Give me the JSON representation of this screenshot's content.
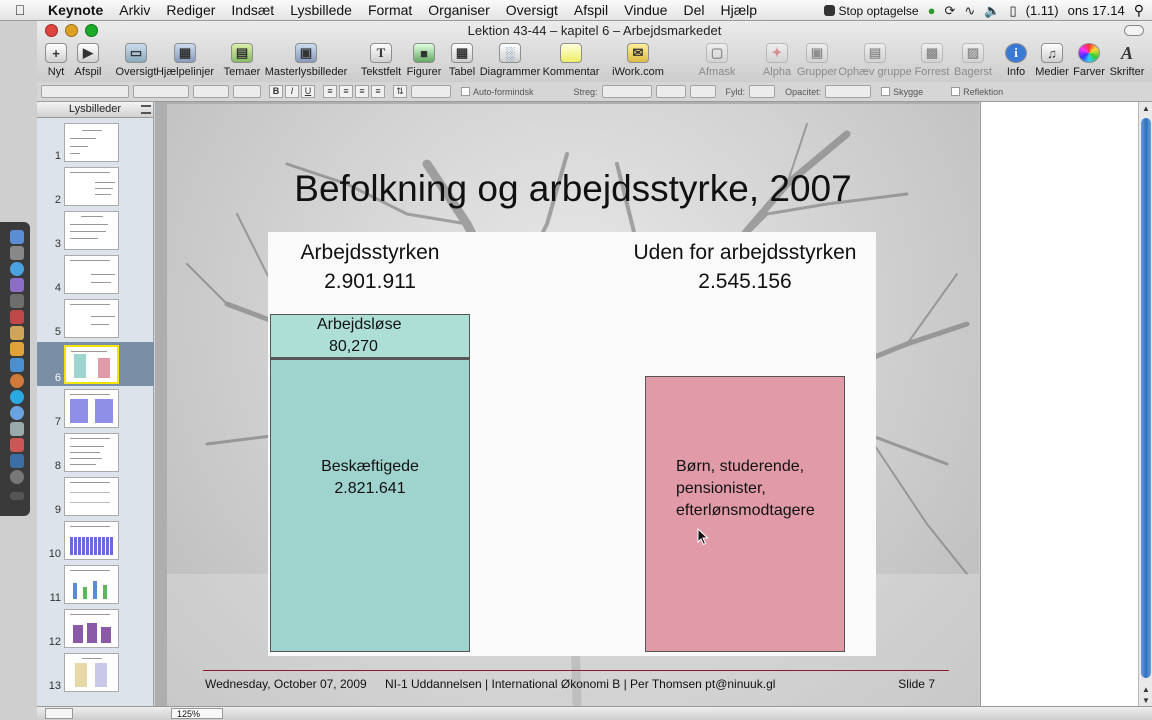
{
  "menubar": {
    "app": "Keynote",
    "items": [
      "Arkiv",
      "Rediger",
      "Indsæt",
      "Lysbillede",
      "Format",
      "Organiser",
      "Oversigt",
      "Afspil",
      "Vindue",
      "Del",
      "Hjælp"
    ],
    "record_label": "Stop optagelse",
    "battery": "(1.11)",
    "clock": "ons 17.14"
  },
  "window": {
    "title": "Lektion 43-44 – kapitel 6 – Arbejdsmarkedet"
  },
  "toolbar": {
    "new": "Nyt",
    "play": "Afspil",
    "view": "Oversigt",
    "guides": "Hjælpelinjer",
    "themes": "Temaer",
    "masters": "Masterlysbilleder",
    "textbox": "Tekstfelt",
    "shapes": "Figurer",
    "table": "Tabel",
    "charts": "Diagrammer",
    "comment": "Kommentar",
    "iwork": "iWork.com",
    "mask": "Afmask",
    "alpha": "Alpha",
    "group": "Grupper",
    "ungroup": "Ophæv gruppe",
    "front": "Forrest",
    "back": "Bagerst",
    "info": "Info",
    "media": "Medier",
    "colors": "Farver",
    "fonts": "Skrifter"
  },
  "formatbar": {
    "autofit": "Auto-formindsk",
    "stroke": "Streg:",
    "fill": "Fyld:",
    "opacity": "Opacitet:",
    "shadow": "Skygge",
    "reflection": "Reflektion"
  },
  "navigator": {
    "header": "Lysbilleder",
    "slides": [
      "1",
      "2",
      "3",
      "4",
      "5",
      "6",
      "7",
      "8",
      "9",
      "10",
      "11",
      "12",
      "13"
    ],
    "selected": "6"
  },
  "slide": {
    "title": "Befolkning og arbejdsstyrke, 2007",
    "left_heading": "Arbejdsstyrken",
    "left_value": "2.901.911",
    "unemployed_label": "Arbejdsløse",
    "unemployed_value": "80,270",
    "employed_label": "Beskæftigede",
    "employed_value": "2.821.641",
    "right_heading": "Uden for arbejdsstyrken",
    "right_value": "2.545.156",
    "outside_line1": "Børn, studerende,",
    "outside_line2": "pensionister,",
    "outside_line3": "efterlønsmodtagere",
    "footer_date": "Wednesday, October 07, 2009",
    "footer_text": "NI-1 Uddannelsen | International Økonomi B | Per Thomsen pt@ninuuk.gl",
    "footer_slide": "Slide 7"
  },
  "bottombar": {
    "zoom": "125%"
  },
  "colors": {
    "teal_box": "#9fd3cd",
    "pink_box": "#e09aa8",
    "footer_rule": "#8b1d2c",
    "selection": "#7a8ea5"
  }
}
